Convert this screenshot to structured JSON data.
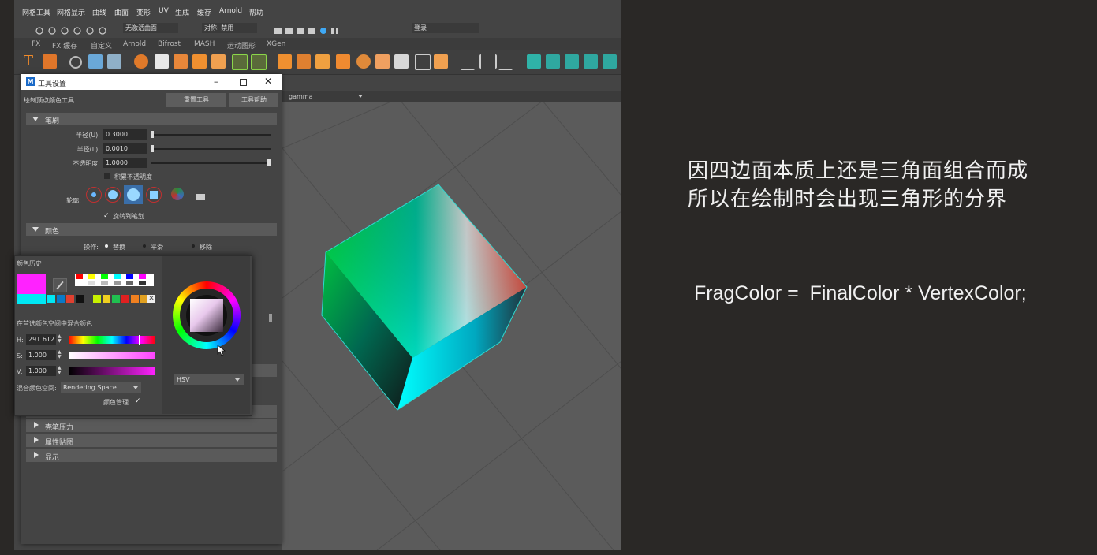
{
  "menubar": {
    "items": [
      "网格工具",
      "网格显示",
      "曲线",
      "曲面",
      "变形",
      "UV",
      "生成",
      "缓存",
      "Arnold",
      "帮助"
    ]
  },
  "statusline": {
    "field1": "无激活曲面",
    "symmetry": "对称: 禁用",
    "login": "登录"
  },
  "shelf_tabs": [
    "FX",
    "FX 缓存",
    "自定义",
    "Arnold",
    "Bifrost",
    "MASH",
    "运动图形",
    "XGen"
  ],
  "panel": {
    "colorspace": "gamma"
  },
  "tool_window": {
    "title": "工具设置",
    "tool_name": "绘制顶点颜色工具",
    "reset_button": "重置工具",
    "help_button": "工具帮助",
    "brush_section": "笔刷",
    "radius_u_label": "半径(U):",
    "radius_u": "0.3000",
    "radius_l_label": "半径(L):",
    "radius_l": "0.0010",
    "opacity_label": "不透明度:",
    "opacity": "1.0000",
    "accumulate_opacity": "积累不透明度",
    "profile_label": "轮廓:",
    "rotate_to_stroke": "旋转到笔划",
    "color_section": "颜色",
    "operation_label": "操作:",
    "op_replace": "替换",
    "op_smooth": "平滑",
    "op_remove": "移除",
    "stylus_pressure": "壳笔压力",
    "attribute_maps": "属性贴图",
    "display": "显示"
  },
  "color_picker": {
    "history_label": "颜色历史",
    "blend_label": "在首选颜色空间中混合颜色",
    "h_label": "H:",
    "h_value": "291.612",
    "s_label": "S:",
    "s_value": "1.000",
    "v_label": "V:",
    "v_value": "1.000",
    "mix_space_label": "混合颜色空间:",
    "mix_space_value": "Rendering Space",
    "color_management": "颜色管理",
    "mode": "HSV",
    "current_color": "#ff22ff",
    "previous_color": "#00e8f4"
  },
  "caption": {
    "line1": "因四边面本质上还是三角面组合而成",
    "line2": "所以在绘制时会出现三角形的分界",
    "formula": "FragColor =  FinalColor * VertexColor;"
  }
}
